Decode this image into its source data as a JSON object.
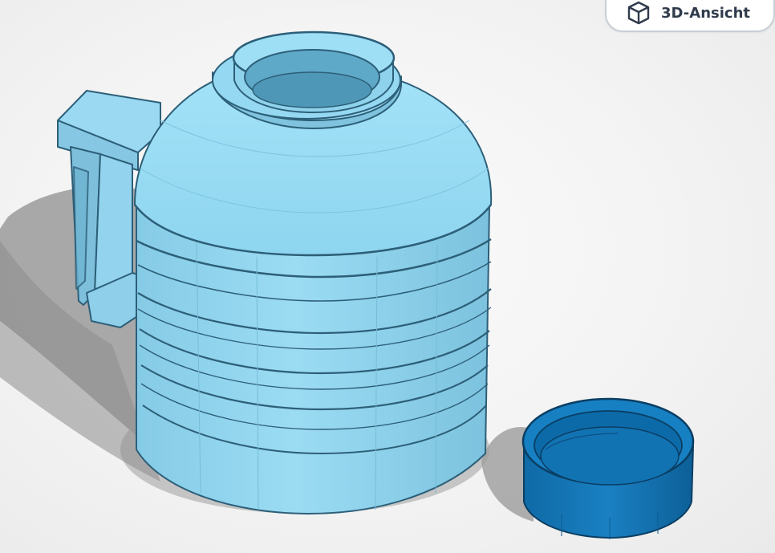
{
  "toolbar": {
    "view_toggle_label": "3D-Ansicht",
    "view_toggle_icon": "cube-icon"
  },
  "scene": {
    "objects": [
      {
        "name": "jug",
        "color": "#8fd6f0",
        "edge_color": "#2d5f78"
      },
      {
        "name": "cap",
        "color": "#1478b8",
        "edge_color": "#0a3e63"
      }
    ],
    "background_color": "#f4f4f4"
  }
}
